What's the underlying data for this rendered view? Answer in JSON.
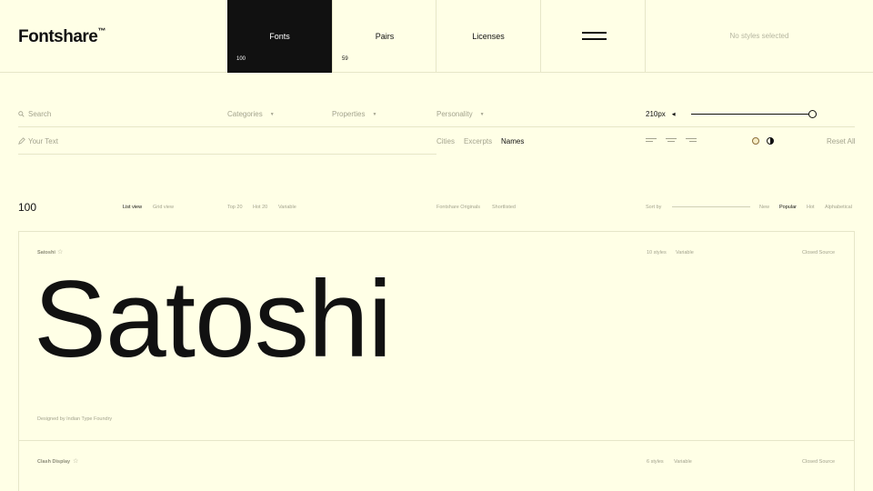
{
  "header": {
    "logo": "Fontshare",
    "logo_tm": "™",
    "nav": [
      {
        "label": "Fonts",
        "count": "100"
      },
      {
        "label": "Pairs",
        "count": "59"
      },
      {
        "label": "Licenses",
        "count": ""
      }
    ],
    "selected_status": "No styles selected"
  },
  "filters": {
    "search_placeholder": "Search",
    "categories": "Categories",
    "properties": "Properties",
    "personality": "Personality",
    "size_value": "210px",
    "size_slider_level": 1.0,
    "text_placeholder": "Your Text",
    "preview_modes": [
      "Cities",
      "Excerpts",
      "Names"
    ],
    "active_preview_mode": "Names",
    "reset": "Reset All"
  },
  "list_header": {
    "count": "100",
    "views": [
      "List view",
      "Grid view"
    ],
    "active_view": "List view",
    "tags": [
      "Top 20",
      "Hot 20",
      "Variable"
    ],
    "collections": [
      "Fontshare Originals",
      "Shortlisted"
    ],
    "sort_label": "Sort by",
    "sort_options": [
      "New",
      "Popular",
      "Hot",
      "Alphabetical"
    ],
    "active_sort": "Popular"
  },
  "fonts": [
    {
      "name": "Satoshi",
      "styles": "10 styles",
      "variable": "Variable",
      "license": "Closed Source",
      "preview": "Satoshi",
      "designer": "Designed by Indian Type Foundry"
    },
    {
      "name": "Clash Display",
      "styles": "6 styles",
      "variable": "Variable",
      "license": "Closed Source",
      "preview": "",
      "designer": ""
    }
  ]
}
